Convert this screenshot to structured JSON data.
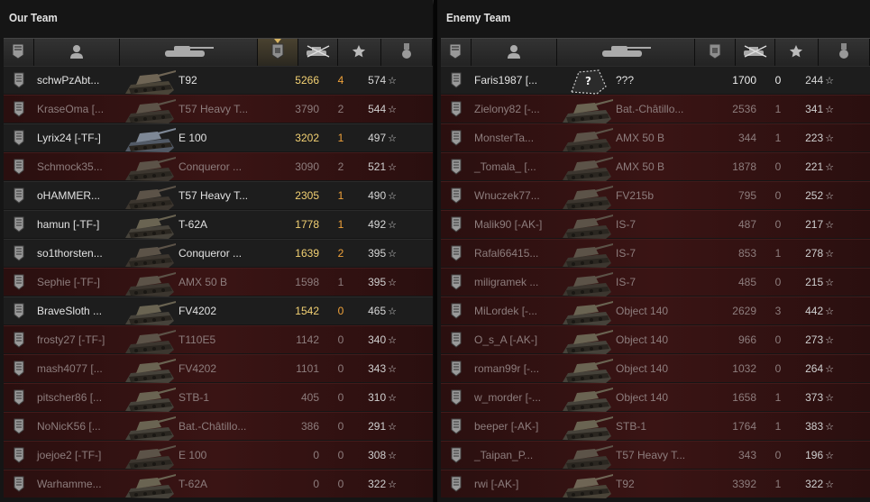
{
  "our_team": {
    "title": "Our Team",
    "players": [
      {
        "name": "schwPzAbt...",
        "vehicle": "T92",
        "damage": "5266",
        "kills": "4",
        "xp": "574",
        "alive": true,
        "tank": "spg"
      },
      {
        "name": "KraseOma [...",
        "vehicle": "T57 Heavy T...",
        "damage": "3790",
        "kills": "2",
        "xp": "544",
        "alive": false,
        "tank": "heavy"
      },
      {
        "name": "Lyrix24 [-TF-]",
        "vehicle": "E 100",
        "damage": "3202",
        "kills": "1",
        "xp": "497",
        "alive": true,
        "tank": "heavy-blue"
      },
      {
        "name": "Schmock35...",
        "vehicle": "Conqueror ...",
        "damage": "3090",
        "kills": "2",
        "xp": "521",
        "alive": false,
        "tank": "heavy"
      },
      {
        "name": "oHAMMER...",
        "vehicle": "T57 Heavy T...",
        "damage": "2305",
        "kills": "1",
        "xp": "490",
        "alive": true,
        "tank": "heavy"
      },
      {
        "name": "hamun [-TF-]",
        "vehicle": "T-62A",
        "damage": "1778",
        "kills": "1",
        "xp": "492",
        "alive": true,
        "tank": "medium"
      },
      {
        "name": "so1thorsten...",
        "vehicle": "Conqueror ...",
        "damage": "1639",
        "kills": "2",
        "xp": "395",
        "alive": true,
        "tank": "heavy"
      },
      {
        "name": "Sephie [-TF-]",
        "vehicle": "AMX 50 B",
        "damage": "1598",
        "kills": "1",
        "xp": "395",
        "alive": false,
        "tank": "heavy"
      },
      {
        "name": "BraveSloth ...",
        "vehicle": "FV4202",
        "damage": "1542",
        "kills": "0",
        "xp": "465",
        "alive": true,
        "tank": "medium"
      },
      {
        "name": "frosty27 [-TF-]",
        "vehicle": "T110E5",
        "damage": "1142",
        "kills": "0",
        "xp": "340",
        "alive": false,
        "tank": "heavy"
      },
      {
        "name": "mash4077 [...",
        "vehicle": "FV4202",
        "damage": "1101",
        "kills": "0",
        "xp": "343",
        "alive": false,
        "tank": "medium"
      },
      {
        "name": "pitscher86 [...",
        "vehicle": "STB-1",
        "damage": "405",
        "kills": "0",
        "xp": "310",
        "alive": false,
        "tank": "medium"
      },
      {
        "name": "NoNicK56 [...",
        "vehicle": "Bat.-Châtillo...",
        "damage": "386",
        "kills": "0",
        "xp": "291",
        "alive": false,
        "tank": "medium"
      },
      {
        "name": "joejoe2 [-TF-]",
        "vehicle": "E 100",
        "damage": "0",
        "kills": "0",
        "xp": "308",
        "alive": false,
        "tank": "heavy"
      },
      {
        "name": "Warhamme...",
        "vehicle": "T-62A",
        "damage": "0",
        "kills": "0",
        "xp": "322",
        "alive": false,
        "tank": "medium"
      }
    ]
  },
  "enemy_team": {
    "title": "Enemy Team",
    "players": [
      {
        "name": "Faris1987 [...",
        "vehicle": "???",
        "damage": "1700",
        "kills": "0",
        "xp": "244",
        "alive": true,
        "tank": "unknown"
      },
      {
        "name": "Zielony82 [-...",
        "vehicle": "Bat.-Châtillo...",
        "damage": "2536",
        "kills": "1",
        "xp": "341",
        "alive": false,
        "tank": "medium"
      },
      {
        "name": "MonsterTa...",
        "vehicle": "AMX 50 B",
        "damage": "344",
        "kills": "1",
        "xp": "223",
        "alive": false,
        "tank": "heavy"
      },
      {
        "name": "_Tomala_ [...",
        "vehicle": "AMX 50 B",
        "damage": "1878",
        "kills": "0",
        "xp": "221",
        "alive": false,
        "tank": "heavy"
      },
      {
        "name": "Wnuczek77...",
        "vehicle": "FV215b",
        "damage": "795",
        "kills": "0",
        "xp": "252",
        "alive": false,
        "tank": "heavy"
      },
      {
        "name": "Malik90 [-AK-]",
        "vehicle": "IS-7",
        "damage": "487",
        "kills": "0",
        "xp": "217",
        "alive": false,
        "tank": "heavy"
      },
      {
        "name": "Rafal66415...",
        "vehicle": "IS-7",
        "damage": "853",
        "kills": "1",
        "xp": "278",
        "alive": false,
        "tank": "heavy"
      },
      {
        "name": "miligramek ...",
        "vehicle": "IS-7",
        "damage": "485",
        "kills": "0",
        "xp": "215",
        "alive": false,
        "tank": "heavy"
      },
      {
        "name": "MiLordek [-...",
        "vehicle": "Object 140",
        "damage": "2629",
        "kills": "3",
        "xp": "442",
        "alive": false,
        "tank": "medium"
      },
      {
        "name": "O_s_A [-AK-]",
        "vehicle": "Object 140",
        "damage": "966",
        "kills": "0",
        "xp": "273",
        "alive": false,
        "tank": "medium"
      },
      {
        "name": "roman99r [-...",
        "vehicle": "Object 140",
        "damage": "1032",
        "kills": "0",
        "xp": "264",
        "alive": false,
        "tank": "medium"
      },
      {
        "name": "w_morder [-...",
        "vehicle": "Object 140",
        "damage": "1658",
        "kills": "1",
        "xp": "373",
        "alive": false,
        "tank": "medium"
      },
      {
        "name": "beeper [-AK-]",
        "vehicle": "STB-1",
        "damage": "1764",
        "kills": "1",
        "xp": "383",
        "alive": false,
        "tank": "medium"
      },
      {
        "name": "_Taipan_P...",
        "vehicle": "T57 Heavy T...",
        "damage": "343",
        "kills": "0",
        "xp": "196",
        "alive": false,
        "tank": "heavy"
      },
      {
        "name": "rwi [-AK-]",
        "vehicle": "T92",
        "damage": "3392",
        "kills": "1",
        "xp": "322",
        "alive": false,
        "tank": "spg"
      }
    ]
  },
  "header_icons": [
    "rank-icon",
    "player-icon",
    "vehicle-icon",
    "damage-icon",
    "kills-icon",
    "xp-icon",
    "medal-icon"
  ],
  "colors": {
    "alive_bg": "#1d1d1d",
    "dead_bg": "#3a1414",
    "damage_gold": "#f3d173",
    "kills_orange": "#f0a23a"
  }
}
